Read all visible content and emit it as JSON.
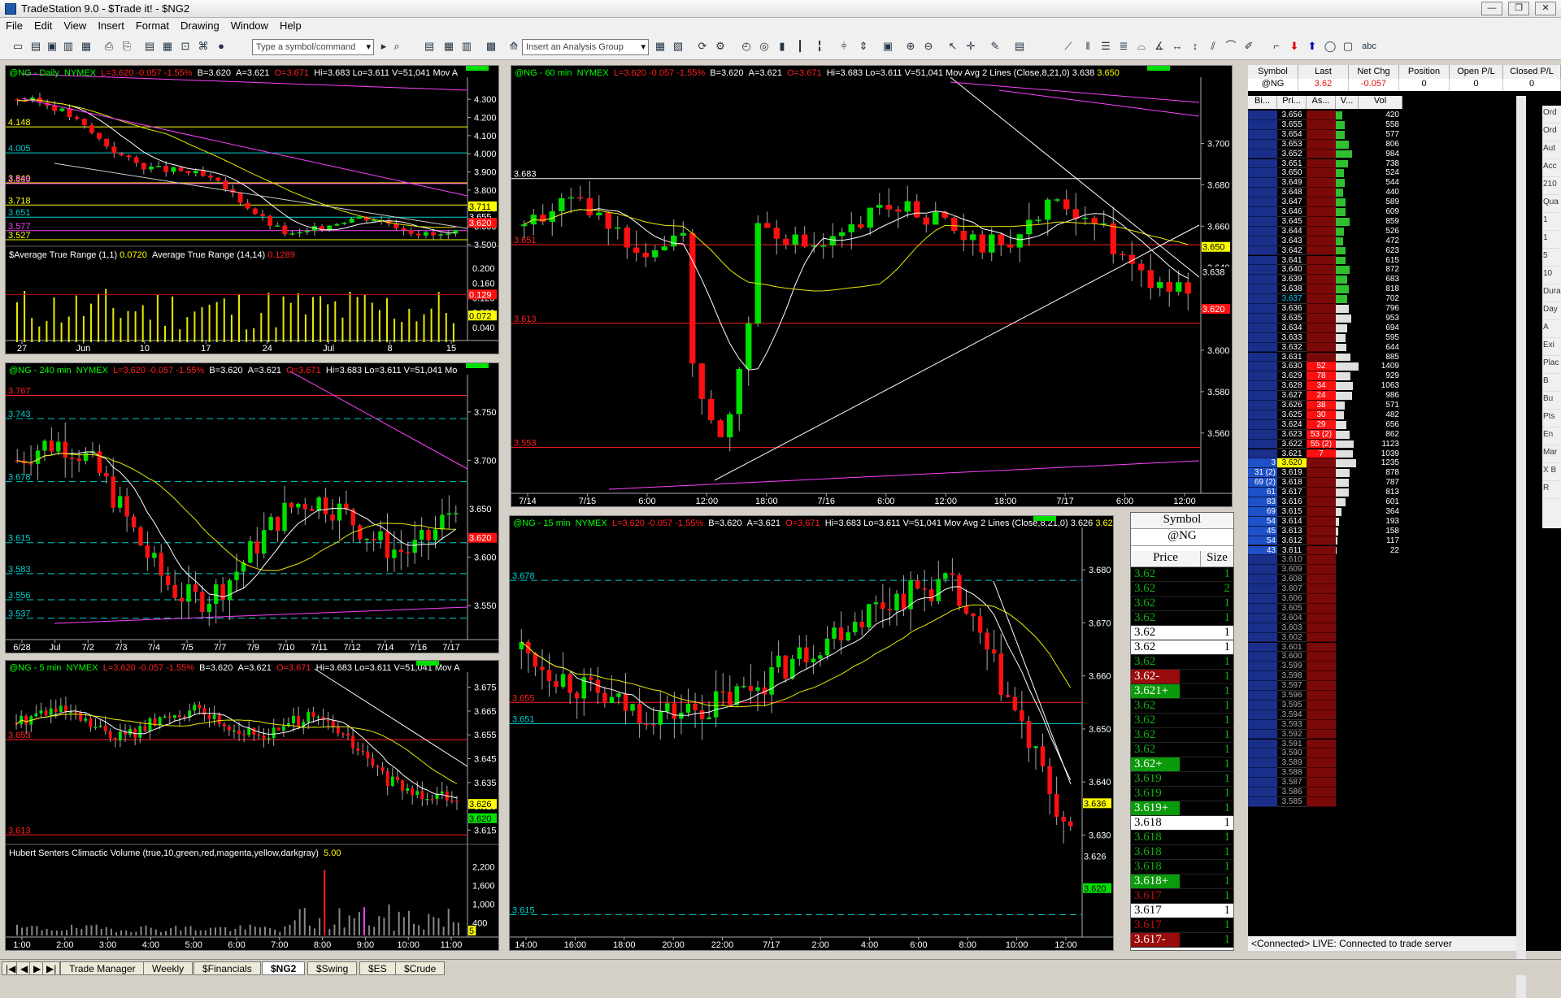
{
  "window": {
    "title": "TradeStation 9.0 - $Trade it! - $NG2",
    "controls": [
      "—",
      "❐",
      "✕"
    ]
  },
  "menu": [
    "File",
    "Edit",
    "View",
    "Insert",
    "Format",
    "Drawing",
    "Window",
    "Help"
  ],
  "toolbar": {
    "symbol_placeholder": "Type a symbol/command",
    "analysis_placeholder": "Insert an Analysis Group",
    "abc": "abc"
  },
  "tabs": {
    "nav": [
      "|◀",
      "◀",
      "▶",
      "▶|"
    ],
    "items": [
      "Trade Manager",
      "Weekly",
      "$Financials",
      "$NG2",
      "$Swing",
      "$ES",
      "$Crude"
    ],
    "active": "$NG2"
  },
  "quote": {
    "sym": "@NG",
    "exch": "NYMEX",
    "L": "L=3.620",
    "chg": "-0.057",
    "pct": "-1.55%",
    "B": "B=3.620",
    "A": "A=3.621",
    "O": "O=3.671",
    "Hi": "Hi=3.683",
    "Lo": "Lo=3.611",
    "V": "V=51,041"
  },
  "charts": {
    "daily": {
      "name": "@NG - Daily",
      "suffix": "Mov A",
      "ind1": "$Average True Range (1,1)",
      "ind1v": "0.0720",
      "ind2": "Average True Range (14,14)",
      "ind2v": "0.1289",
      "levels": [
        "4.148",
        "4.005",
        "3.836",
        "3.718",
        "3.651",
        "3.577",
        "3.527",
        "3.840"
      ],
      "yticks": [
        "4.300",
        "4.200",
        "4.100",
        "4.000",
        "3.900",
        "3.800",
        "3.700",
        "3.600",
        "3.500"
      ],
      "tags": [
        "3.711",
        "3.655",
        "3.620"
      ],
      "atrticks": [
        "0.200",
        "0.160",
        "0.120",
        "0.080",
        "0.040"
      ],
      "atrtags": [
        "0.129",
        "0.072"
      ],
      "xticks": [
        "27",
        "Jun",
        "10",
        "17",
        "24",
        "Jul",
        "8",
        "15"
      ]
    },
    "m240": {
      "name": "@NG - 240 min",
      "suffix": "Mo",
      "levels": [
        "3.767",
        "3.743",
        "3.678",
        "3.615",
        "3.583",
        "3.556",
        "3.537"
      ],
      "yticks": [
        "3.750",
        "3.700",
        "3.650",
        "3.600",
        "3.550"
      ],
      "tags": [
        "3.650",
        "3.620"
      ],
      "xticks": [
        "6/28",
        "Jul",
        "7/2",
        "7/3",
        "7/4",
        "7/5",
        "7/7",
        "7/9",
        "7/10",
        "7/11",
        "7/12",
        "7/14",
        "7/16",
        "7/17"
      ]
    },
    "m5": {
      "name": "@NG - 5 min",
      "suffix": "Mov A",
      "levels": [
        "3.653",
        "3.613"
      ],
      "yticks": [
        "3.675",
        "3.665",
        "3.655",
        "3.645",
        "3.635",
        "3.625",
        "3.615"
      ],
      "tags": [
        "3.626",
        "3.620"
      ],
      "ind": "Hubert Senters Climactic Volume (true,10,green,red,magenta,yellow,darkgray)",
      "indv": "5.00",
      "volticks": [
        "2,200",
        "1,600",
        "1,000",
        "400"
      ],
      "voltag": "5",
      "xticks": [
        "1:00",
        "2:00",
        "3:00",
        "4:00",
        "5:00",
        "6:00",
        "7:00",
        "8:00",
        "9:00",
        "10:00",
        "11:00"
      ]
    },
    "m60": {
      "name": "@NG - 60 min",
      "ma": "Mov Avg 2 Lines (Close,8,21,0)",
      "ma1": "3.638",
      "ma2": "3.650",
      "levels": [
        "3.683",
        "3.651",
        "3.613",
        "3.553"
      ],
      "yticks": [
        "3.700",
        "3.680",
        "3.660",
        "3.640",
        "3.620",
        "3.600",
        "3.580",
        "3.560"
      ],
      "tags": [
        "3.650",
        "3.638",
        "3.620"
      ],
      "xticks": [
        "7/14",
        "7/15",
        "6:00",
        "12:00",
        "18:00",
        "7/16",
        "6:00",
        "12:00",
        "18:00",
        "7/17",
        "6:00",
        "12:00"
      ]
    },
    "m15": {
      "name": "@NG - 15 min",
      "ma": "Mov Avg 2 Lines (Close,8,21,0)",
      "ma1": "3.626",
      "ma2": "3.620",
      "levels": [
        "3.678",
        "3.655",
        "3.651",
        "3.615"
      ],
      "yticks": [
        "3.680",
        "3.670",
        "3.660",
        "3.650",
        "3.640",
        "3.630"
      ],
      "tags": [
        "3.636",
        "3.626",
        "3.620"
      ],
      "xticks": [
        "14:00",
        "16:00",
        "18:00",
        "20:00",
        "22:00",
        "7/17",
        "2:00",
        "4:00",
        "6:00",
        "8:00",
        "10:00",
        "12:00"
      ]
    }
  },
  "tns": {
    "symbol_label": "Symbol",
    "symbol": "@NG",
    "price_h": "Price",
    "size_h": "Size",
    "rows": [
      [
        "3.62",
        "1",
        "g"
      ],
      [
        "3.62",
        "2",
        "g"
      ],
      [
        "3.62",
        "1",
        "g"
      ],
      [
        "3.62",
        "1",
        "g"
      ],
      [
        "3.62",
        "1",
        "w"
      ],
      [
        "3.62",
        "1",
        "w"
      ],
      [
        "3.62",
        "1",
        "g"
      ],
      [
        "3.62-",
        "1",
        "rb"
      ],
      [
        "3.621+",
        "1",
        "gb"
      ],
      [
        "3.62",
        "1",
        "g"
      ],
      [
        "3.62",
        "1",
        "g"
      ],
      [
        "3.62",
        "1",
        "g"
      ],
      [
        "3.62",
        "1",
        "g"
      ],
      [
        "3.62+",
        "1",
        "gb"
      ],
      [
        "3.619",
        "1",
        "g"
      ],
      [
        "3.619",
        "1",
        "g"
      ],
      [
        "3.619+",
        "1",
        "gb"
      ],
      [
        "3.618",
        "1",
        "w"
      ],
      [
        "3.618",
        "1",
        "g"
      ],
      [
        "3.618",
        "1",
        "g"
      ],
      [
        "3.618",
        "1",
        "g"
      ],
      [
        "3.618+",
        "1",
        "gb"
      ],
      [
        "3.617",
        "1",
        "r"
      ],
      [
        "3.617",
        "1",
        "w"
      ],
      [
        "3.617",
        "1",
        "r"
      ],
      [
        "3.617-",
        "1",
        "rb"
      ]
    ]
  },
  "matrix": {
    "headers": [
      "Symbol",
      "Last",
      "Net Chg",
      "Position",
      "Open P/L",
      "Closed P/L"
    ],
    "row": [
      "@NG",
      "3.62",
      "-0.057",
      "0",
      "0",
      "0"
    ],
    "col_headers": [
      "Bi...",
      "Pri...",
      "As...",
      "V...",
      "Vol"
    ],
    "status": "<Connected> LIVE:  Connected to trade server",
    "prices": [
      "3.656",
      "3.655",
      "3.654",
      "3.653",
      "3.652",
      "3.651",
      "3.650",
      "3.649",
      "3.648",
      "3.647",
      "3.646",
      "3.645",
      "3.644",
      "3.643",
      "3.642",
      "3.641",
      "3.640",
      "3.639",
      "3.638",
      "3.637",
      "3.636",
      "3.635",
      "3.634",
      "3.633",
      "3.632",
      "3.631",
      "3.630",
      "3.629",
      "3.628",
      "3.627",
      "3.626",
      "3.625",
      "3.624",
      "3.623",
      "3.622",
      "3.621",
      "3.620",
      "3.619",
      "3.618",
      "3.617",
      "3.616",
      "3.615",
      "3.614",
      "3.613",
      "3.612",
      "3.611",
      "3.610",
      "3.609",
      "3.608",
      "3.607",
      "3.606",
      "3.605",
      "3.604",
      "3.603",
      "3.602",
      "3.601",
      "3.600",
      "3.599",
      "3.598",
      "3.597",
      "3.596",
      "3.595",
      "3.594",
      "3.593",
      "3.592",
      "3.591",
      "3.590",
      "3.589",
      "3.588",
      "3.587",
      "3.586",
      "3.585"
    ],
    "vols": [
      "420",
      "558",
      "577",
      "806",
      "984",
      "738",
      "524",
      "544",
      "440",
      "589",
      "609",
      "859",
      "526",
      "472",
      "623",
      "615",
      "872",
      "683",
      "818",
      "702",
      "796",
      "953",
      "694",
      "595",
      "644",
      "885",
      "1409",
      "929",
      "1063",
      "986",
      "571",
      "482",
      "656",
      "862",
      "1123",
      "1039",
      "1235",
      "878",
      "787",
      "813",
      "601",
      "364",
      "193",
      "158",
      "117",
      "22"
    ],
    "asks": {
      "3.630": "52",
      "3.629": "78",
      "3.628": "34",
      "3.627": "24",
      "3.626": "38",
      "3.625": "30",
      "3.624": "29",
      "3.623": "53 (2)",
      "3.622": "55 (2)",
      "3.621": "7"
    },
    "bids": {
      "3.620": "3",
      "3.619": "31 (2)",
      "3.618": "69 (2)",
      "3.617": "61",
      "3.616": "83",
      "3.615": "69",
      "3.614": "54",
      "3.613": "45",
      "3.612": "54",
      "3.611": "43"
    },
    "side": [
      "Ord",
      "Ord",
      "Aut",
      "Acc",
      "210",
      "Qua",
      "1",
      "1",
      "5",
      "10",
      "Dura",
      "Day",
      "A",
      "Exi",
      "Plac",
      "B",
      "Bu",
      "Pts",
      "En",
      "Mar",
      "X B",
      "R"
    ]
  }
}
